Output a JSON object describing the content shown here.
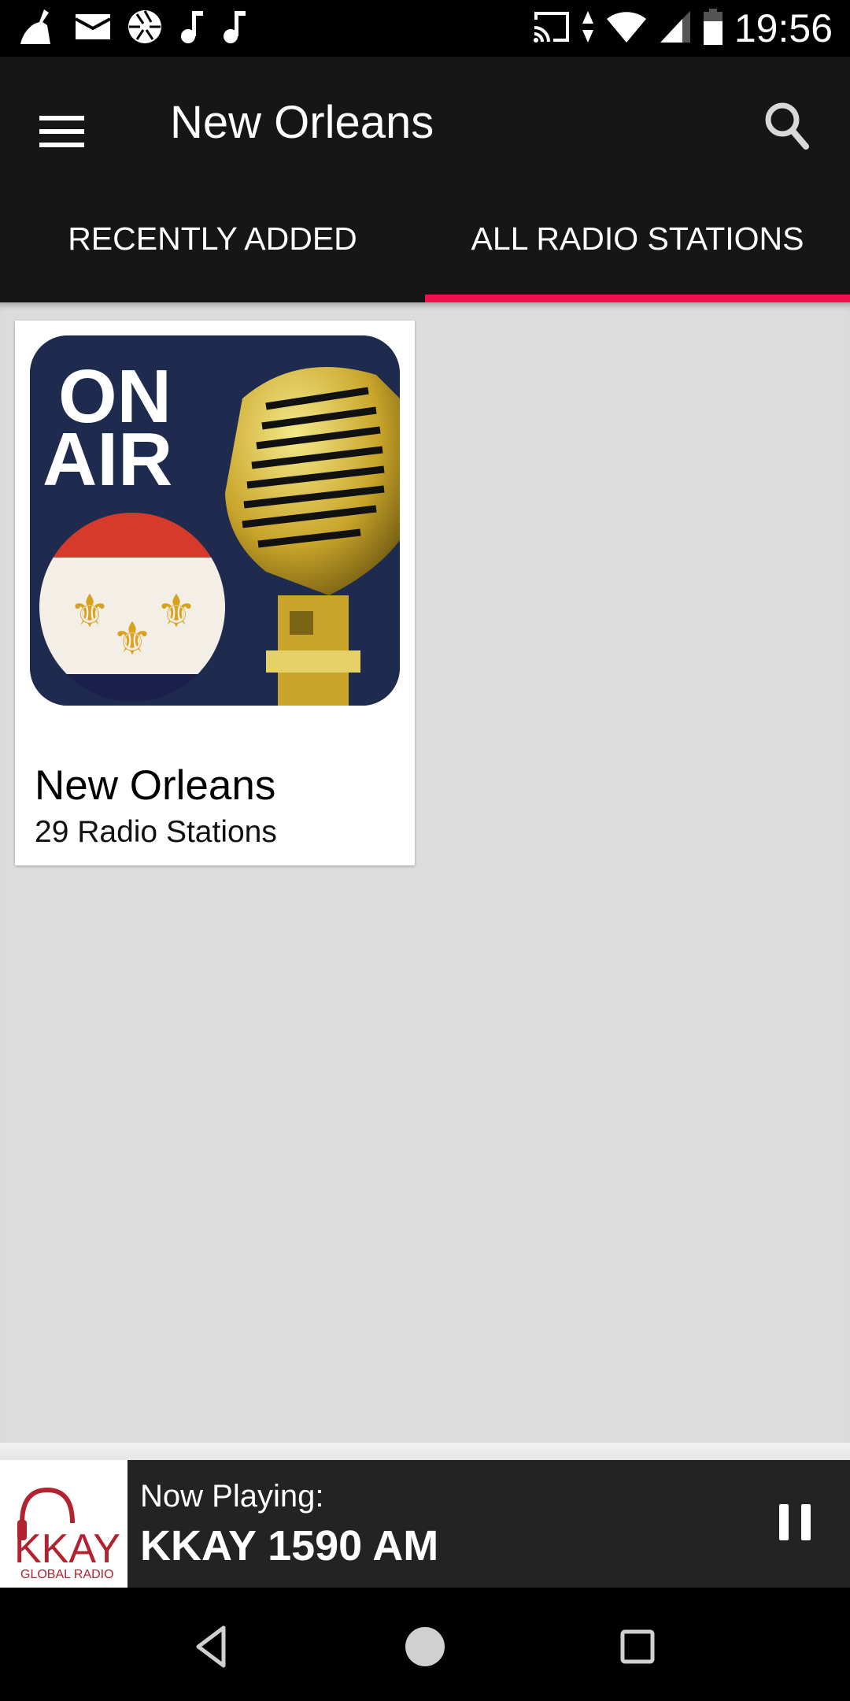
{
  "status_bar": {
    "time": "19:56",
    "left_icons": [
      "cleaner-icon",
      "mail-icon",
      "camera-aperture-icon",
      "music-note-icon",
      "music-note-icon"
    ],
    "right_icons": [
      "cast-icon",
      "data-arrows-icon",
      "wifi-icon",
      "signal-icon",
      "battery-icon"
    ]
  },
  "app_bar": {
    "title": "New Orleans",
    "menu_icon": "hamburger-menu-icon",
    "search_icon": "search-icon"
  },
  "tabs": [
    {
      "label": "RECENTLY ADDED",
      "active": false
    },
    {
      "label": "ALL RADIO STATIONS",
      "active": true
    }
  ],
  "accent_color": "#f0104e",
  "cards": [
    {
      "image": "on-air-microphone-new-orleans-flag",
      "image_text_line1": "ON",
      "image_text_line2": "AIR",
      "title": "New Orleans",
      "subtitle": "29 Radio Stations"
    }
  ],
  "now_playing": {
    "label": "Now Playing:",
    "station": "KKAY 1590 AM",
    "logo_text": "KKAY",
    "logo_subtext": "GLOBAL RADIO",
    "logo_color": "#b3222f",
    "control": "pause-icon"
  },
  "nav_bar": {
    "buttons": [
      "back-icon",
      "home-icon",
      "recents-icon"
    ]
  }
}
